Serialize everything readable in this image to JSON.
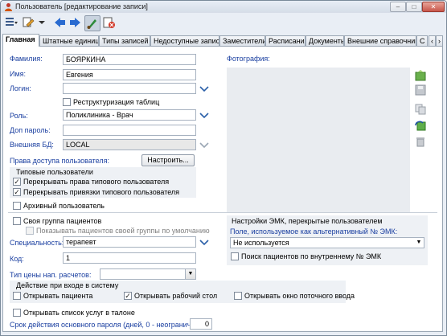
{
  "window": {
    "title": "Пользователь [редактирование записи]",
    "minimize": "–",
    "maximize": "□",
    "close": "✕"
  },
  "toolbar": {
    "icons": [
      "list-icon",
      "edit-icon",
      "arrow-left-icon",
      "arrow-right-icon",
      "brush-icon",
      "cancel-icon"
    ]
  },
  "tabs": [
    {
      "label": "Главная"
    },
    {
      "label": "Штатные единицы"
    },
    {
      "label": "Типы записей"
    },
    {
      "label": "Недоступные записи"
    },
    {
      "label": "Заместители"
    },
    {
      "label": "Расписания"
    },
    {
      "label": "Документы"
    },
    {
      "label": "Внешние справочники"
    },
    {
      "label": "С"
    }
  ],
  "form": {
    "surname_label": "Фамилия:",
    "surname_value": "БОЯРКИНА",
    "name_label": "Имя:",
    "name_value": "Евгения",
    "login_label": "Логин:",
    "login_value": "",
    "restructure_label": "Реструктуризация таблиц",
    "role_label": "Роль:",
    "role_value": "Поликлиника - Врач",
    "extra_password_label": "Доп пароль:",
    "extra_password_value": "",
    "external_db_label": "Внешняя БД:",
    "external_db_value": "LOCAL",
    "photo_label": "Фотография:",
    "access_rights_label": "Права доступа пользователя:",
    "configure_button": "Настроить...",
    "typical_users_header": "Типовые пользователи",
    "override_rights_label": "Перекрывать права типового пользователя",
    "override_bindings_label": "Перекрывать привязки типового пользователя",
    "archive_user_label": "Архивный пользователь",
    "own_group_label": "Своя группа пациентов",
    "show_group_label": "Показывать пациентов своей группы по умолчанию",
    "specialty_label": "Специальность:",
    "specialty_value": "терапевт",
    "code_label": "Код:",
    "code_value": "1",
    "emk_header": "Настройки ЭМК, перекрытые пользователем",
    "emk_field_label": "Поле, используемое как альтернативный № ЭМК:",
    "emk_field_value": "Не используется",
    "emk_search_label": "Поиск пациентов по внутреннему № ЭМК",
    "price_type_label": "Тип цены нап. расчетов:",
    "price_type_value": "",
    "login_action_header": "Действие при входе в систему",
    "open_patient_label": "Открывать пациента",
    "open_desktop_label": "Открывать рабочий стол",
    "open_stream_label": "Открывать окно поточного ввода",
    "open_services_label": "Открывать список услуг в талоне",
    "password_term_label": "Срок действия основного пароля (дней, 0 - неограничен):",
    "password_term_value": "0"
  },
  "checks": {
    "restructure": false,
    "override_rights": true,
    "override_bindings": true,
    "archive_user": false,
    "own_group": false,
    "show_group": false,
    "emk_search": false,
    "open_patient": false,
    "open_desktop": true,
    "open_stream": false,
    "open_services": false
  },
  "colors": {
    "label_blue": "#1a3fa0",
    "group_bg": "#eef1f5",
    "window_bg": "#e9eef5"
  }
}
